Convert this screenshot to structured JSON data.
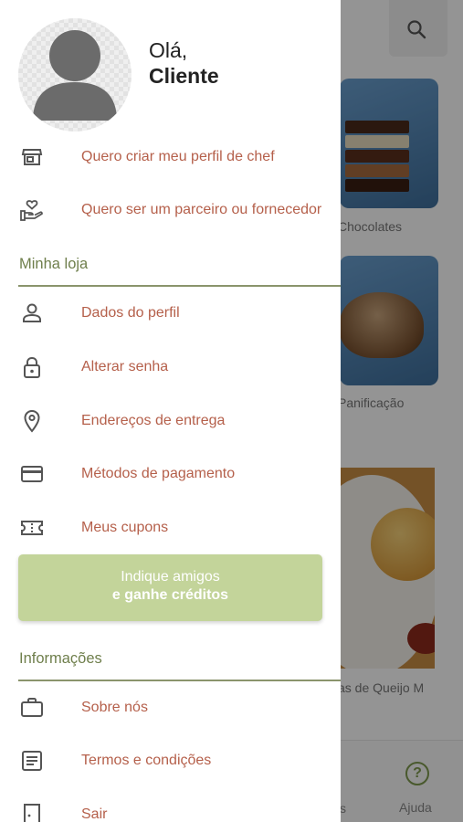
{
  "background": {
    "categories": [
      {
        "label": "Chocolates"
      },
      {
        "label": "Panificação"
      }
    ],
    "food_caption": "as de Queijo M",
    "bottom_nav": {
      "partial_label": "s",
      "help_label": "Ajuda",
      "help_glyph": "?"
    }
  },
  "drawer": {
    "greeting_line1": "Olá,",
    "greeting_line2": "Cliente",
    "top_items": [
      {
        "label": "Quero criar meu perfil de chef",
        "icon": "store-icon"
      },
      {
        "label": "Quero ser um parceiro ou fornecedor",
        "icon": "hand-heart-icon"
      }
    ],
    "section_store": "Minha loja",
    "store_items": [
      {
        "label": "Dados do perfil",
        "icon": "person-icon"
      },
      {
        "label": "Alterar senha",
        "icon": "lock-icon"
      },
      {
        "label": "Endereços de entrega",
        "icon": "location-pin-icon"
      },
      {
        "label": "Métodos de pagamento",
        "icon": "credit-card-icon"
      },
      {
        "label": "Meus cupons",
        "icon": "ticket-icon"
      }
    ],
    "promo": {
      "line1": "Indique amigos",
      "line2": "e ganhe créditos"
    },
    "section_info": "Informações",
    "info_items": [
      {
        "label": "Sobre nós",
        "icon": "briefcase-icon"
      },
      {
        "label": "Termos e condições",
        "icon": "document-icon"
      },
      {
        "label": "Sair",
        "icon": "exit-door-icon"
      }
    ]
  },
  "colors": {
    "menu_text": "#b5604b",
    "section_text": "#6f7f4c",
    "promo_bg": "#c3d49a",
    "icon": "#555555"
  }
}
